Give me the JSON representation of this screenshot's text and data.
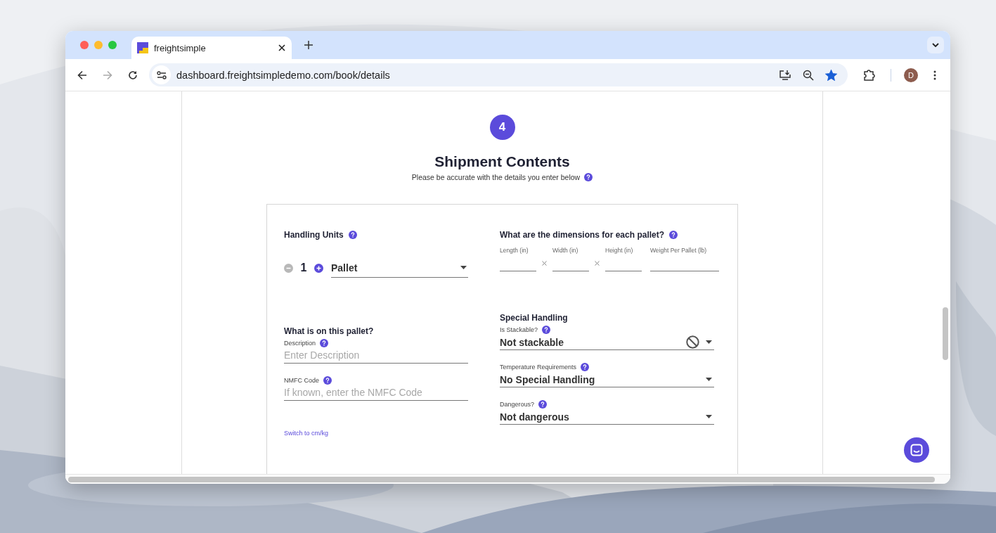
{
  "browser": {
    "tab": {
      "title": "freightsimple",
      "selected": true
    },
    "url": "dashboard.freightsimpledemo.com/book/details",
    "bookmarked": true,
    "profile_initial": "D"
  },
  "step": {
    "number": "4",
    "title": "Shipment Contents",
    "subtitle": "Please be accurate with the details you enter below"
  },
  "handling_units": {
    "label": "Handling Units",
    "count": "1",
    "unit_type": "Pallet",
    "decrease_disabled": true
  },
  "dimensions": {
    "label": "What are the dimensions for each pallet?",
    "fields": [
      {
        "label": "Length (in)"
      },
      {
        "label": "Width (in)"
      },
      {
        "label": "Height (in)"
      },
      {
        "label": "Weight Per Pallet (lb)"
      }
    ]
  },
  "contents": {
    "label": "What is on this pallet?",
    "fields": [
      {
        "label": "Description",
        "placeholder": "Enter Description"
      },
      {
        "label": "NMFC Code",
        "placeholder": "If known, enter the NMFC Code"
      }
    ],
    "unit_switch": "Switch to cm/kg"
  },
  "special_handling": {
    "label": "Special Handling",
    "fields": [
      {
        "label": "Is Stackable?",
        "value": "Not stackable",
        "prohibited": true
      },
      {
        "label": "Temperature Requirements",
        "value": "No Special Handling",
        "prohibited": false
      },
      {
        "label": "Dangerous?",
        "value": "Not dangerous",
        "prohibited": false
      }
    ]
  }
}
